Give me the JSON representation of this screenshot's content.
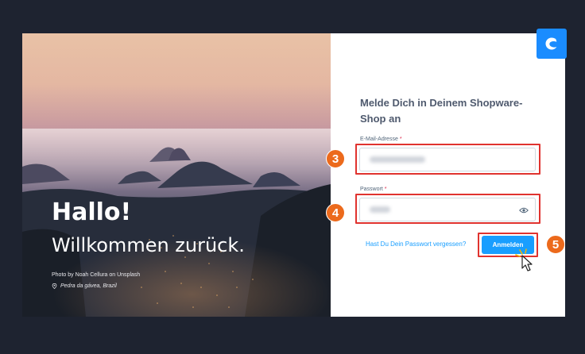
{
  "hero": {
    "greeting": "Hallo!",
    "welcome": "Willkommen zurück.",
    "photo_credit": "Photo by Noah Cellura on Unsplash",
    "location": "Pedra da gávea, Brazil",
    "location_icon": "map-pin-icon"
  },
  "brand": {
    "icon": "shopware-logo-icon",
    "color": "#1a8cff"
  },
  "form": {
    "title": "Melde Dich in Deinem Shopware-Shop an",
    "email_label": "E-Mail-Adresse",
    "password_label": "Passwort",
    "required_marker": "*",
    "forgot_link": "Hast Du Dein Passwort vergessen?",
    "submit_label": "Anmelden",
    "accent_color": "#189eff"
  },
  "annotations": {
    "steps": [
      "3",
      "4",
      "5"
    ],
    "highlight_color": "#e0332f",
    "badge_color": "#ec6a1c"
  }
}
